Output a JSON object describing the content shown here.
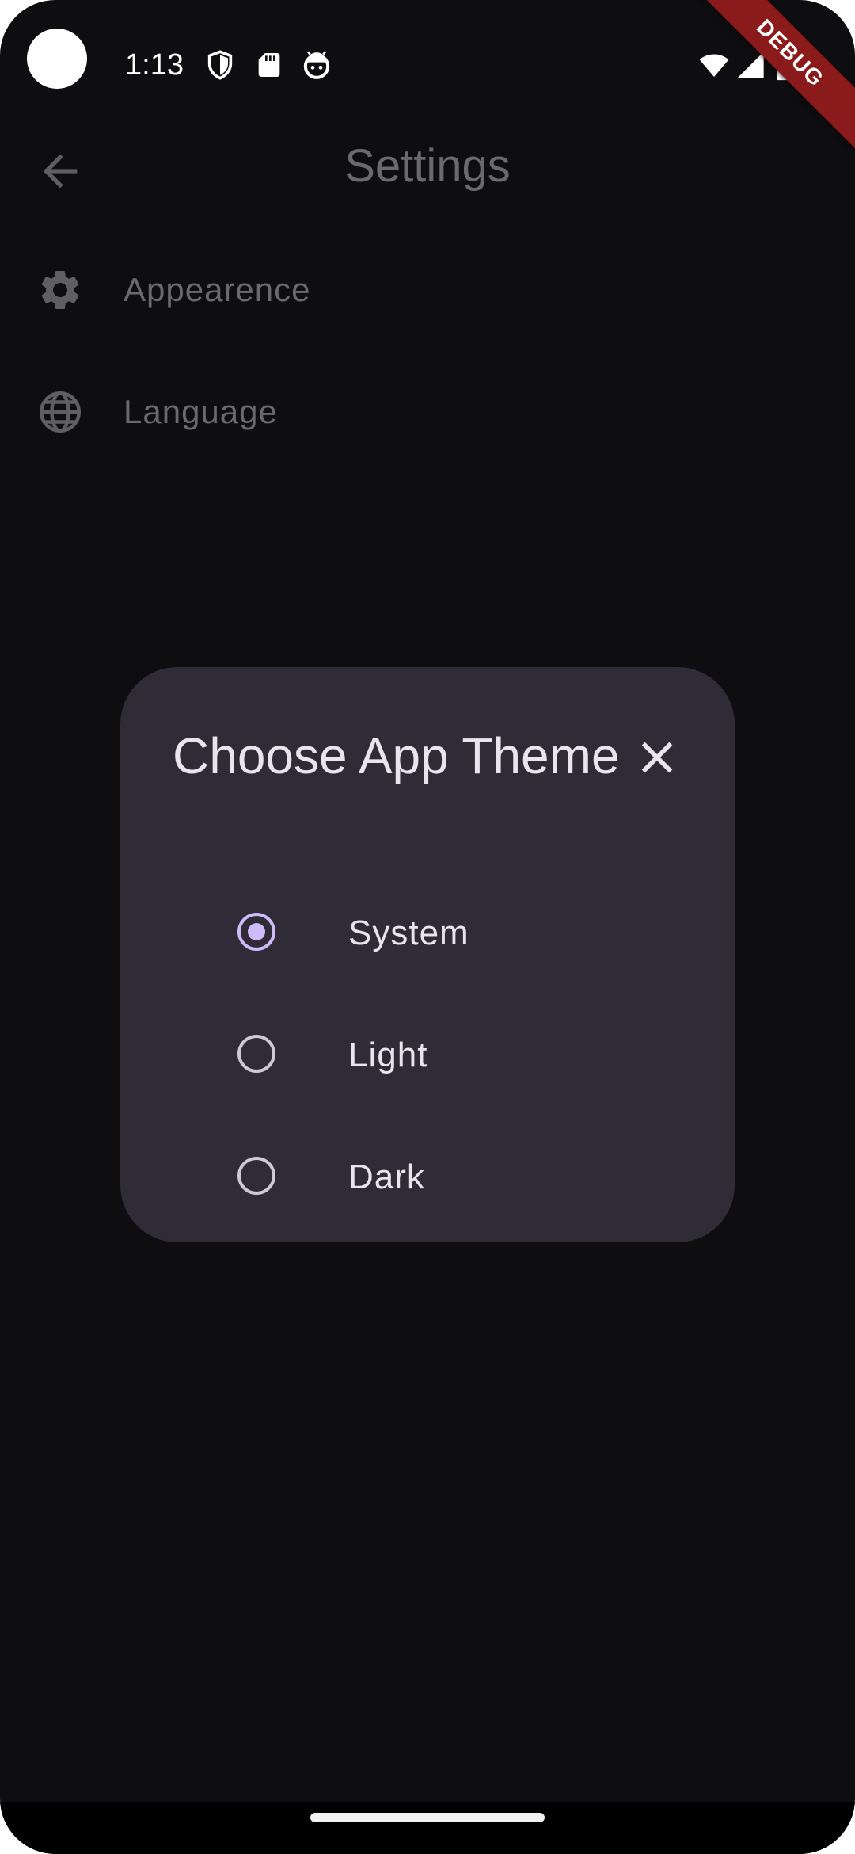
{
  "status_bar": {
    "time": "1:13",
    "left_icons": [
      "shield-icon",
      "sd-card-icon",
      "android-face-icon"
    ],
    "right_icons": [
      "wifi-icon",
      "cellular-signal-icon",
      "battery-icon"
    ]
  },
  "debug_banner": {
    "label": "DEBUG",
    "color": "#8b1a1a"
  },
  "app_bar": {
    "title": "Settings",
    "back_icon": "arrow-back-icon"
  },
  "settings": {
    "items": [
      {
        "label": "Appearence",
        "icon": "gear-icon"
      },
      {
        "label": "Language",
        "icon": "globe-icon"
      }
    ]
  },
  "dialog": {
    "title": "Choose App Theme",
    "close_icon": "close-icon",
    "options": [
      {
        "label": "System",
        "selected": true
      },
      {
        "label": "Light",
        "selected": false
      },
      {
        "label": "Dark",
        "selected": false
      }
    ]
  },
  "colors": {
    "background": "#0e0e10",
    "dialog_background": "#2f2c38",
    "accent": "#cdbcf8",
    "dim_text": "#6a6a6e",
    "dialog_text": "#e9e4ee"
  }
}
